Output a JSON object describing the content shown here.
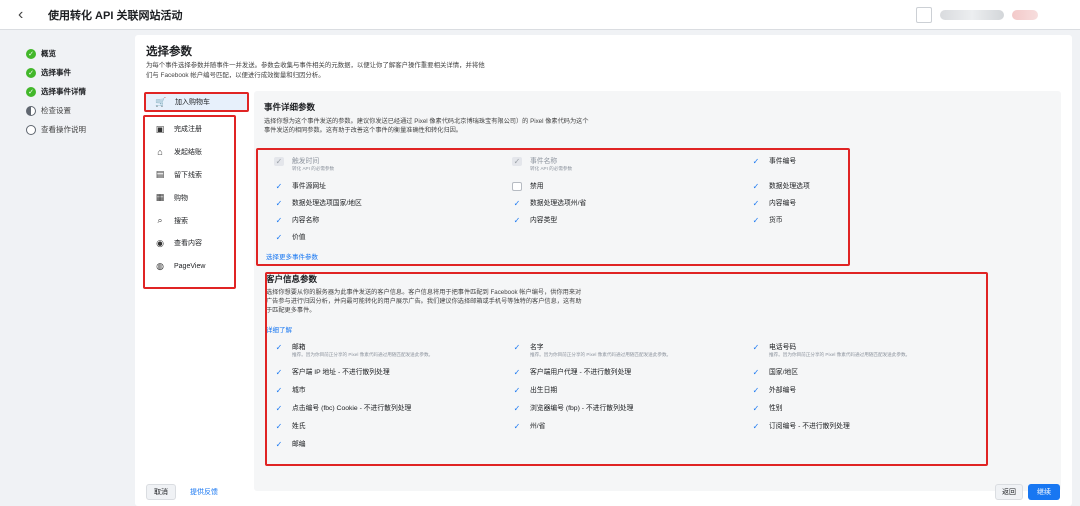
{
  "header": {
    "title": "使用转化 API 关联网站活动"
  },
  "steps": [
    {
      "label": "概览",
      "state": "done"
    },
    {
      "label": "选择事件",
      "state": "done"
    },
    {
      "label": "选择事件详情",
      "state": "done"
    },
    {
      "label": "检查设置",
      "state": "current"
    },
    {
      "label": "查看操作说明",
      "state": "todo"
    }
  ],
  "main": {
    "title": "选择参数",
    "description": "为每个事件选择参数并随事件一并发送。参数会收集与事件相关的元数据，以便让你了解客户操作重要相关详情，并将他们与 Facebook 帐户编号匹配，以便进行成效衡量和归因分析。"
  },
  "events": [
    {
      "label": "加入购物车",
      "icon": "cart-icon",
      "glyph": "🛒"
    },
    {
      "label": "完成注册",
      "icon": "register-icon",
      "glyph": "▣"
    },
    {
      "label": "发起结账",
      "icon": "checkout-icon",
      "glyph": "⌂"
    },
    {
      "label": "留下线索",
      "icon": "lead-icon",
      "glyph": "▤"
    },
    {
      "label": "购物",
      "icon": "purchase-icon",
      "glyph": "▦"
    },
    {
      "label": "搜索",
      "icon": "search-icon",
      "glyph": "⌕"
    },
    {
      "label": "查看内容",
      "icon": "view-content-icon",
      "glyph": "◉"
    },
    {
      "label": "PageView",
      "icon": "pageview-icon",
      "glyph": "◍"
    }
  ],
  "event_params": {
    "title": "事件详细参数",
    "description": "选择你想为这个事件发送的参数。建议你发送已经通过 Pixel 像素代码北京博瑞珠宝有限公司）的 Pixel 像素代码为这个事件发送的相同参数。这有助于改善这个事件的衡量准确性和转化归因。",
    "more_link": "选择更多事件参数",
    "items": [
      {
        "label": "触发时间",
        "sub": "转化 API 的必需参数",
        "state": "disabled"
      },
      {
        "label": "事件名称",
        "sub": "转化 API 的必需参数",
        "state": "disabled"
      },
      {
        "label": "事件编号",
        "sub": "",
        "state": "checked"
      },
      {
        "label": "事件源网址",
        "sub": "",
        "state": "checked"
      },
      {
        "label": "禁用",
        "sub": "",
        "state": "unchecked"
      },
      {
        "label": "数据处理选项",
        "sub": "",
        "state": "checked"
      },
      {
        "label": "数据处理选项国家/地区",
        "sub": "",
        "state": "checked"
      },
      {
        "label": "数据处理选项州/省",
        "sub": "",
        "state": "checked"
      },
      {
        "label": "内容编号",
        "sub": "",
        "state": "checked"
      },
      {
        "label": "内容名称",
        "sub": "",
        "state": "checked"
      },
      {
        "label": "内容类型",
        "sub": "",
        "state": "checked"
      },
      {
        "label": "货币",
        "sub": "",
        "state": "checked"
      },
      {
        "label": "价值",
        "sub": "",
        "state": "checked"
      }
    ]
  },
  "customer_params": {
    "title": "客户信息参数",
    "description": "选择你想要从你的服务器为此事件发送的客户信息。客户信息将用于把事件匹配到 Facebook 帐户编号，供你用来对广告参与进行归因分析，并向最可能转化的用户展示广告。我们建议你选择邮箱或手机号等独特的客户信息，这有助于匹配更多事件。",
    "learn_more": "详细了解",
    "items": [
      {
        "label": "邮箱",
        "sub": "推荐。因为你目前正分享的 Pixel 像素代码通过用随匹配发送此参数。"
      },
      {
        "label": "名字",
        "sub": "推荐。因为你目前正分享的 Pixel 像素代码通过用随匹配发送此参数。"
      },
      {
        "label": "电话号码",
        "sub": "推荐。因为你目前正分享的 Pixel 像素代码通过用随匹配发送此参数。"
      },
      {
        "label": "客户端 IP 地址 - 不进行散列处理",
        "sub": ""
      },
      {
        "label": "客户端用户代理 - 不进行散列处理",
        "sub": ""
      },
      {
        "label": "国家/地区",
        "sub": ""
      },
      {
        "label": "城市",
        "sub": ""
      },
      {
        "label": "出生日期",
        "sub": ""
      },
      {
        "label": "外部编号",
        "sub": ""
      },
      {
        "label": "点击编号 (fbc) Cookie - 不进行散列处理",
        "sub": ""
      },
      {
        "label": "浏览器编号 (fbp) - 不进行散列处理",
        "sub": ""
      },
      {
        "label": "性别",
        "sub": ""
      },
      {
        "label": "姓氏",
        "sub": ""
      },
      {
        "label": "州/省",
        "sub": ""
      },
      {
        "label": "订阅编号 - 不进行散列处理",
        "sub": ""
      },
      {
        "label": "邮编",
        "sub": ""
      }
    ]
  },
  "footer": {
    "cancel": "取消",
    "feedback": "提供反馈",
    "back": "返回",
    "next": "继续"
  }
}
